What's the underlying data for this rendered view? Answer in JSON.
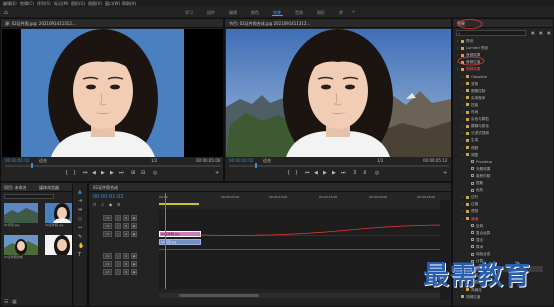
{
  "menu": [
    "编辑(E)",
    "剪辑(C)",
    "序列(S)",
    "标记(M)",
    "图形(G)",
    "视图(V)",
    "窗口(W)",
    "帮助(H)"
  ],
  "workspace_tabs": [
    {
      "label": "学习",
      "active": false
    },
    {
      "label": "组件",
      "active": false
    },
    {
      "label": "编辑",
      "active": false
    },
    {
      "label": "颜色",
      "active": false
    },
    {
      "label": "效果",
      "active": true
    },
    {
      "label": "音频",
      "active": false
    },
    {
      "label": "图形",
      "active": false
    },
    {
      "label": "库",
      "active": false
    }
  ],
  "source_monitor": {
    "title": "源: 02证件照.jpg: 2021091411312...",
    "timecode": "00:00:01:02",
    "fit": "适合",
    "page": "1/2",
    "duration": "00:00:05:00"
  },
  "program_monitor": {
    "title": "节目: 02证件照合成.jpg 2021091411312...",
    "timecode": "00:00:01:02",
    "fit": "适合",
    "page": "1/2",
    "duration": "00:00:05:12"
  },
  "effects_panel": {
    "tab": "效果",
    "items": [
      {
        "label": "预设",
        "type": "folder",
        "indent": 0
      },
      {
        "label": "Lumetri 预设",
        "type": "folder",
        "indent": 0
      },
      {
        "label": "音频效果",
        "type": "folder",
        "indent": 0
      },
      {
        "label": "音频过渡",
        "type": "folder",
        "indent": 0
      },
      {
        "label": "视频效果",
        "type": "folder",
        "indent": 0,
        "highlight": true
      },
      {
        "label": "Obsolete",
        "type": "folder",
        "indent": 1
      },
      {
        "label": "变换",
        "type": "folder",
        "indent": 1
      },
      {
        "label": "图像控制",
        "type": "folder",
        "indent": 1
      },
      {
        "label": "实用程序",
        "type": "folder",
        "indent": 1
      },
      {
        "label": "扭曲",
        "type": "folder",
        "indent": 1
      },
      {
        "label": "时间",
        "type": "folder",
        "indent": 1
      },
      {
        "label": "杂色与颗粒",
        "type": "folder",
        "indent": 1
      },
      {
        "label": "模糊与锐化",
        "type": "folder",
        "indent": 1
      },
      {
        "label": "沉浸式视频",
        "type": "folder",
        "indent": 1
      },
      {
        "label": "生成",
        "type": "folder",
        "indent": 1
      },
      {
        "label": "视频",
        "type": "folder",
        "indent": 1
      },
      {
        "label": "调整",
        "type": "folder",
        "indent": 1
      },
      {
        "label": "ProcAmp",
        "type": "item",
        "indent": 2
      },
      {
        "label": "光照效果",
        "type": "item",
        "indent": 2
      },
      {
        "label": "卷积内核",
        "type": "item",
        "indent": 2
      },
      {
        "label": "提取",
        "type": "item",
        "indent": 2
      },
      {
        "label": "色阶",
        "type": "item",
        "indent": 2
      },
      {
        "label": "过时",
        "type": "folder",
        "indent": 1
      },
      {
        "label": "过渡",
        "type": "folder",
        "indent": 1
      },
      {
        "label": "透视",
        "type": "folder",
        "indent": 1
      },
      {
        "label": "通道",
        "type": "folder",
        "indent": 1,
        "highlight": true
      },
      {
        "label": "反转",
        "type": "item",
        "indent": 2
      },
      {
        "label": "复合运算",
        "type": "item",
        "indent": 2
      },
      {
        "label": "混合",
        "type": "item",
        "indent": 2
      },
      {
        "label": "算术",
        "type": "item",
        "indent": 2
      },
      {
        "label": "纯色合成",
        "type": "item",
        "indent": 2
      },
      {
        "label": "计算",
        "type": "item",
        "indent": 2
      },
      {
        "label": "设置遮罩",
        "type": "item",
        "indent": 2,
        "selected": true
      },
      {
        "label": "键控",
        "type": "folder",
        "indent": 1
      },
      {
        "label": "颜色校正",
        "type": "folder",
        "indent": 1
      },
      {
        "label": "风格化",
        "type": "folder",
        "indent": 1
      },
      {
        "label": "视频过渡",
        "type": "folder",
        "indent": 0
      }
    ]
  },
  "project_panel": {
    "tabs": [
      "项目: 未命名",
      "媒体浏览器"
    ],
    "items": [
      {
        "label": "01风景.jpg",
        "kind": "landscape"
      },
      {
        "label": "02证件照.jpg",
        "kind": "portrait"
      },
      {
        "label": "02证件照合成",
        "kind": "landscape"
      },
      {
        "label": "",
        "kind": "portrait"
      }
    ]
  },
  "timeline": {
    "tab": "02证件照合成",
    "timecode": "00:00:01:02",
    "ruler": [
      "00:00",
      "00:00:05:00",
      "00:00:10:00",
      "00:00:15:00",
      "00:00:20:00",
      "00:00:25:00"
    ],
    "tracks": [
      "V3",
      "V2",
      "V1",
      "A1",
      "A2",
      "A3"
    ],
    "clips": [
      {
        "track": "V2",
        "label": "02证件照.jpg"
      },
      {
        "track": "V1",
        "label": "01风景.jpg"
      }
    ]
  },
  "watermark": "最需教育",
  "colors": {
    "accent": "#3a8dde",
    "annotation": "#e53935",
    "clip_pink": "#d57ab9",
    "clip_blue": "#6f8fc6"
  }
}
